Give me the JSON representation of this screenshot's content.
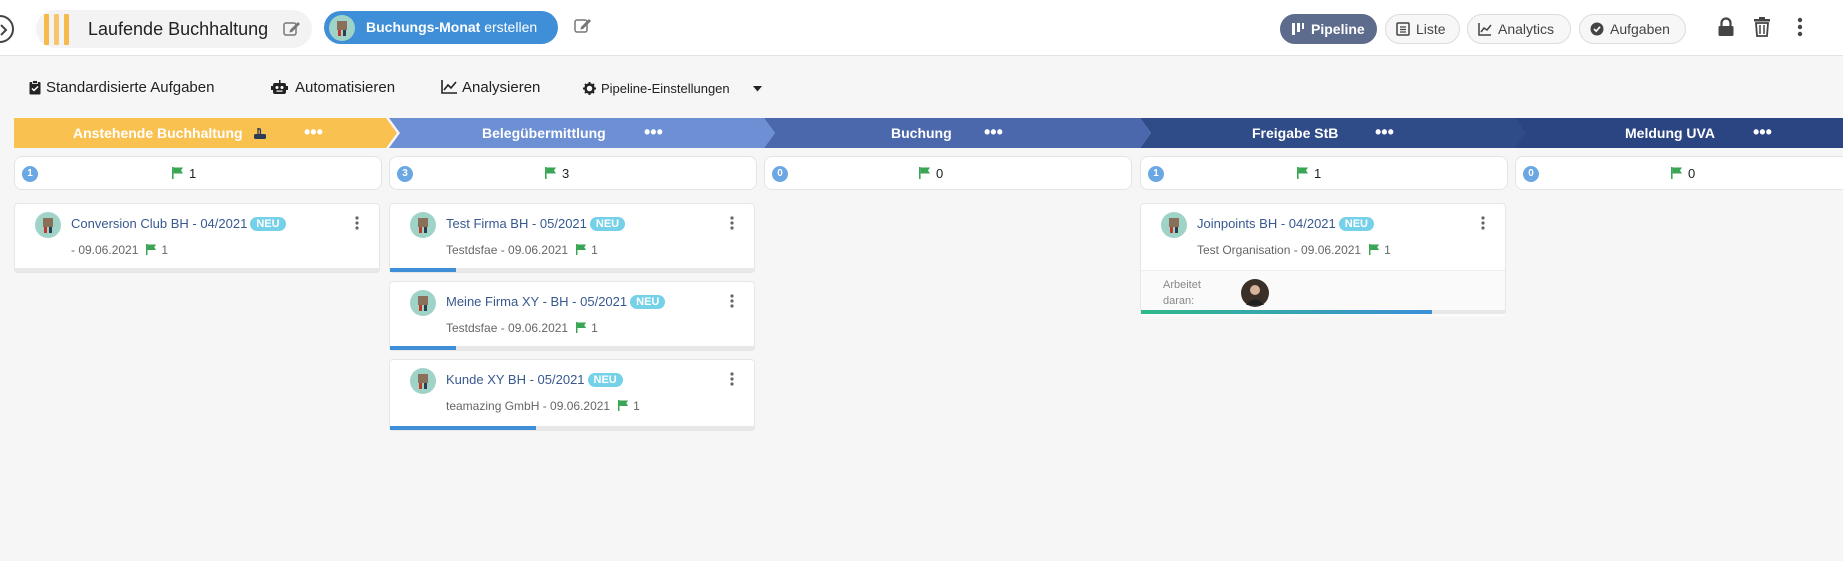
{
  "header": {
    "title": "Laufende Buchhaltung",
    "create_button_bold": "Buchungs-Monat",
    "create_button_rest": " erstellen",
    "views": [
      {
        "label": "Pipeline",
        "icon": "pipeline-icon",
        "active": true
      },
      {
        "label": "Liste",
        "icon": "list-icon",
        "active": false
      },
      {
        "label": "Analytics",
        "icon": "analytics-icon",
        "active": false
      },
      {
        "label": "Aufgaben",
        "icon": "check-circle-icon",
        "active": false
      }
    ]
  },
  "toolbar": {
    "tasks": "Standardisierte Aufgaben",
    "automate": "Automatisieren",
    "analyze": "Analysieren",
    "settings": "Pipeline-Einstellungen"
  },
  "stages": [
    {
      "name": "Anstehende Buchhaltung",
      "color": "#f9c150",
      "count": "1",
      "flags": "1",
      "cards": [
        {
          "title": "Conversion Club BH - 04/2021",
          "badge": "NEU",
          "subtitle": " - 09.06.2021",
          "flags": "1",
          "progress": 0
        }
      ]
    },
    {
      "name": "Belegübermittlung",
      "color": "#6d8fd3",
      "count": "3",
      "flags": "3",
      "cards": [
        {
          "title": "Test Firma BH - 05/2021",
          "badge": "NEU",
          "subtitle": "Testdsfae - 09.06.2021",
          "flags": "1",
          "progress": 0.18
        },
        {
          "title": "Meine Firma XY - BH - 05/2021",
          "badge": "NEU",
          "subtitle": "Testdsfae - 09.06.2021",
          "flags": "1",
          "progress": 0.18
        },
        {
          "title": "Kunde XY BH - 05/2021",
          "badge": "NEU",
          "subtitle": "teamazing GmbH - 09.06.2021",
          "flags": "1",
          "progress": 0.4
        }
      ]
    },
    {
      "name": "Buchung",
      "color": "#4a68ab",
      "count": "0",
      "flags": "0",
      "cards": []
    },
    {
      "name": "Freigabe StB",
      "color": "#2f4b88",
      "count": "1",
      "flags": "1",
      "cards": [
        {
          "title": "Joinpoints BH - 04/2021",
          "badge": "NEU",
          "subtitle": "Test Organisation - 09.06.2021",
          "flags": "1",
          "progress": 0.8,
          "worker_label": "Arbeitet daran:"
        }
      ]
    },
    {
      "name": "Meldung UVA",
      "color": "#2b4583",
      "count": "0",
      "flags": "0",
      "cards": []
    }
  ]
}
